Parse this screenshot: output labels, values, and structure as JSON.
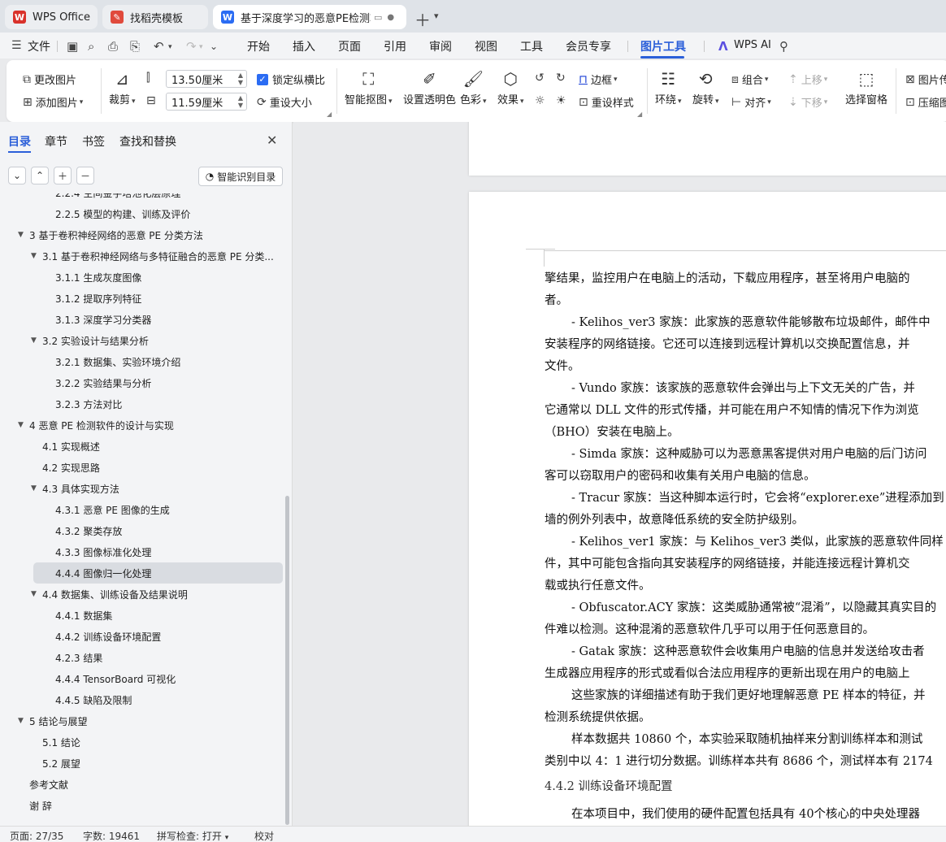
{
  "tabs": [
    {
      "label": "WPS Office",
      "icon": "wps-logo-icon",
      "color": "#d9322b"
    },
    {
      "label": "找稻壳模板",
      "icon": "docer-icon",
      "color": "#e04a3c"
    },
    {
      "label": "基于深度学习的恶意PE检测软",
      "icon": "writer-doc-icon",
      "color": "#2b6cf3"
    }
  ],
  "menu": {
    "file": "文件",
    "items": [
      "开始",
      "插入",
      "页面",
      "引用",
      "审阅",
      "视图",
      "工具",
      "会员专享",
      "图片工具"
    ],
    "active": "图片工具",
    "ai": "WPS AI"
  },
  "ribbon": {
    "change_image": "更改图片",
    "add_image": "添加图片",
    "crop": "裁剪",
    "width_value": "13.50厘米",
    "height_value": "11.59厘米",
    "lock_ratio": "锁定纵横比",
    "resize": "重设大小",
    "smart_cutout": "智能抠图",
    "set_transparent": "设置透明色",
    "color": "色彩",
    "effects": "效果",
    "border": "边框",
    "reset_style": "重设样式",
    "wrap": "环绕",
    "rotate": "旋转",
    "group": "组合",
    "align": "对齐",
    "move_up": "上移",
    "move_down": "下移",
    "select_pane": "选择窗格",
    "image_trans": "图片传",
    "compress": "压缩图"
  },
  "nav": {
    "tabs": [
      "目录",
      "章节",
      "书签",
      "查找和替换"
    ],
    "smart_toc": "智能识别目录",
    "toc": [
      {
        "text": "2.2.4  空间金字塔池化层原理",
        "level": 3,
        "expand": ""
      },
      {
        "text": "2.2.5  模型的构建、训练及评价",
        "level": 3,
        "expand": ""
      },
      {
        "text": "3  基于卷积神经网络的恶意 PE 分类方法",
        "level": 1,
        "expand": "▼"
      },
      {
        "text": "3.1  基于卷积神经网络与多特征融合的恶意 PE 分类...",
        "level": 2,
        "expand": "▼"
      },
      {
        "text": "3.1.1  生成灰度图像",
        "level": 3,
        "expand": ""
      },
      {
        "text": "3.1.2  提取序列特征",
        "level": 3,
        "expand": ""
      },
      {
        "text": "3.1.3  深度学习分类器",
        "level": 3,
        "expand": ""
      },
      {
        "text": "3.2  实验设计与结果分析",
        "level": 2,
        "expand": "▼"
      },
      {
        "text": "3.2.1  数据集、实验环境介绍",
        "level": 3,
        "expand": ""
      },
      {
        "text": "3.2.2  实验结果与分析",
        "level": 3,
        "expand": ""
      },
      {
        "text": "3.2.3  方法对比",
        "level": 3,
        "expand": ""
      },
      {
        "text": "4  恶意 PE 检测软件的设计与实现",
        "level": 1,
        "expand": "▼"
      },
      {
        "text": "4.1  实现概述",
        "level": 2,
        "expand": ""
      },
      {
        "text": "4.2  实现思路",
        "level": 2,
        "expand": ""
      },
      {
        "text": "4.3 具体实现方法",
        "level": 2,
        "expand": "▼"
      },
      {
        "text": "4.3.1 恶意 PE 图像的生成",
        "level": 3,
        "expand": ""
      },
      {
        "text": "4.3.2 聚类存放",
        "level": 3,
        "expand": ""
      },
      {
        "text": "4.3.3 图像标准化处理",
        "level": 3,
        "expand": ""
      },
      {
        "text": "4.4.4 图像归一化处理",
        "level": 3,
        "expand": "",
        "selected": true
      },
      {
        "text": "4.4 数据集、训练设备及结果说明",
        "level": 2,
        "expand": "▼"
      },
      {
        "text": "4.4.1 数据集",
        "level": 3,
        "expand": ""
      },
      {
        "text": "4.4.2 训练设备环境配置",
        "level": 3,
        "expand": ""
      },
      {
        "text": "4.2.3  结果",
        "level": 3,
        "expand": ""
      },
      {
        "text": "4.4.4 TensorBoard 可视化",
        "level": 3,
        "expand": ""
      },
      {
        "text": "4.4.5  缺陷及限制",
        "level": 3,
        "expand": ""
      },
      {
        "text": "5  结论与展望",
        "level": 1,
        "expand": "▼"
      },
      {
        "text": "5.1  结论",
        "level": 2,
        "expand": ""
      },
      {
        "text": "5.2  展望",
        "level": 2,
        "expand": ""
      },
      {
        "text": "参考文献",
        "level": 1,
        "expand": ""
      },
      {
        "text": "谢    辞",
        "level": 1,
        "expand": ""
      }
    ]
  },
  "document": {
    "lines": [
      {
        "text": "擎结果，监控用户在电脑上的活动，下载应用程序，甚至将用户电脑的",
        "indent": false
      },
      {
        "text": "者。",
        "indent": false
      },
      {
        "text": "- Kelihos_ver3 家族：此家族的恶意软件能够散布垃圾邮件，邮件中",
        "indent": true
      },
      {
        "text": "安装程序的网络链接。它还可以连接到远程计算机以交换配置信息，并",
        "indent": false
      },
      {
        "text": "文件。",
        "indent": false
      },
      {
        "text": "- Vundo 家族：该家族的恶意软件会弹出与上下文无关的广告，并",
        "indent": true
      },
      {
        "text": "它通常以 DLL 文件的形式传播，并可能在用户不知情的情况下作为浏览",
        "indent": false
      },
      {
        "text": "（BHO）安装在电脑上。",
        "indent": false
      },
      {
        "text": "- Simda 家族：这种威胁可以为恶意黑客提供对用户电脑的后门访问",
        "indent": true
      },
      {
        "text": "客可以窃取用户的密码和收集有关用户电脑的信息。",
        "indent": false
      },
      {
        "text": "- Tracur 家族：当这种脚本运行时，它会将“explorer.exe”进程添加到",
        "indent": true
      },
      {
        "text": "墙的例外列表中，故意降低系统的安全防护级别。",
        "indent": false
      },
      {
        "text": "- Kelihos_ver1 家族：与 Kelihos_ver3 类似，此家族的恶意软件同样",
        "indent": true
      },
      {
        "text": "件，其中可能包含指向其安装程序的网络链接，并能连接远程计算机交",
        "indent": false
      },
      {
        "text": "载或执行任意文件。",
        "indent": false
      },
      {
        "text": "- Obfuscator.ACY 家族：这类威胁通常被“混淆”，以隐藏其真实目的",
        "indent": true
      },
      {
        "text": "件难以检测。这种混淆的恶意软件几乎可以用于任何恶意目的。",
        "indent": false
      },
      {
        "text": "- Gatak 家族：这种恶意软件会收集用户电脑的信息并发送给攻击者",
        "indent": true
      },
      {
        "text": "生成器应用程序的形式或看似合法应用程序的更新出现在用户的电脑上",
        "indent": false
      },
      {
        "text": "这些家族的详细描述有助于我们更好地理解恶意 PE 样本的特征，并",
        "indent": true
      },
      {
        "text": "检测系统提供依据。",
        "indent": false
      },
      {
        "text": "样本数据共 10860 个，本实验采取随机抽样来分割训练样本和测试",
        "indent": true
      },
      {
        "text": "类别中以 4：1 进行切分数据。训练样本共有 8686 个，测试样本有 2174",
        "indent": false
      }
    ],
    "heading": "4.4.2 训练设备环境配置",
    "last_line": "在本项目中，我们使用的硬件配置包括具有 40个核心的中央处理器"
  },
  "status": {
    "page": "页面: 27/35",
    "words": "字数: 19461",
    "spell": "拼写检查: 打开",
    "proof": "校对"
  }
}
